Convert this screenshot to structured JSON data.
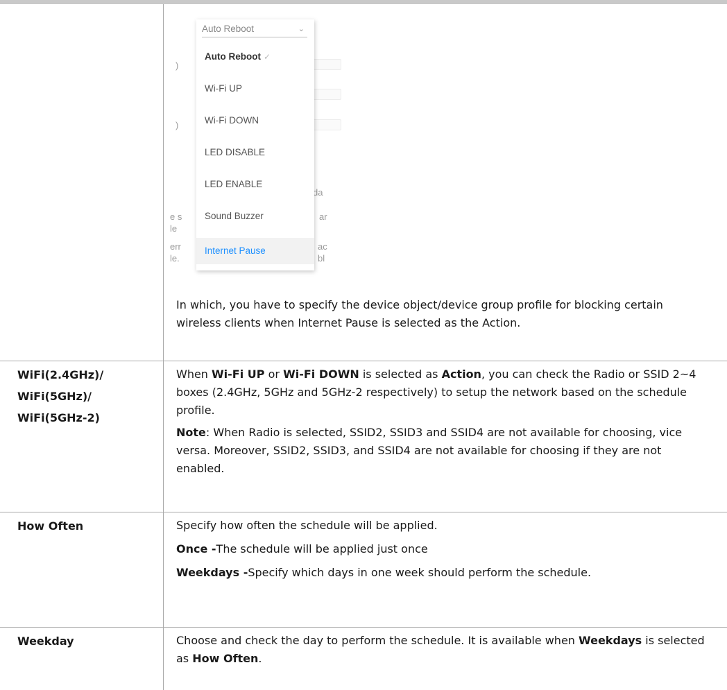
{
  "dropdown": {
    "current_value": "Auto Reboot",
    "options": [
      {
        "label": "Auto Reboot",
        "selected": true
      },
      {
        "label": "Wi-Fi UP"
      },
      {
        "label": "Wi-Fi DOWN"
      },
      {
        "label": "LED DISABLE"
      },
      {
        "label": "LED ENABLE"
      },
      {
        "label": "Sound Buzzer"
      },
      {
        "label": "Internet Pause",
        "highlighted": true
      }
    ],
    "background_fragments": [
      ")",
      ")",
      "da",
      "e s",
      "ar",
      "le",
      "err",
      "ac",
      "le.",
      "bl"
    ]
  },
  "rows": {
    "action": {
      "description": "In which, you have to specify the device object/device group profile for blocking certain wireless clients when Internet Pause is selected as the Action."
    },
    "wifi": {
      "label_lines": [
        "WiFi(2.4GHz)/",
        "WiFi(5GHz)/",
        "WiFi(5GHz-2)"
      ],
      "p1": {
        "t1": "When ",
        "b1": "Wi-Fi UP",
        "t2": " or ",
        "b2": "Wi-Fi DOWN",
        "t3": " is selected as ",
        "b3": "Action",
        "t4": ", you can check the Radio or SSID 2~4 boxes (2.4GHz, 5GHz and 5GHz-2 respectively) to setup the network based on the schedule profile."
      },
      "note": {
        "bold": "Note",
        "text": ": When Radio is selected, SSID2, SSID3 and SSID4 are not available for choosing, vice versa. Moreover, SSID2, SSID3, and SSID4 are not available for choosing if they are not enabled."
      }
    },
    "how_often": {
      "label": "How Often",
      "p1": "Specify how often the schedule will be applied.",
      "once_bold": "Once -",
      "once_text": "The schedule will be applied just once",
      "weekdays_bold": "Weekdays -",
      "weekdays_text": "Specify which days in one week should perform the schedule."
    },
    "weekday": {
      "label": "Weekday",
      "t1": "Choose and check the day to perform the schedule. It is available when ",
      "b1": "Weekdays",
      "t2": " is selected as ",
      "b2": "How Often",
      "t3": "."
    }
  }
}
